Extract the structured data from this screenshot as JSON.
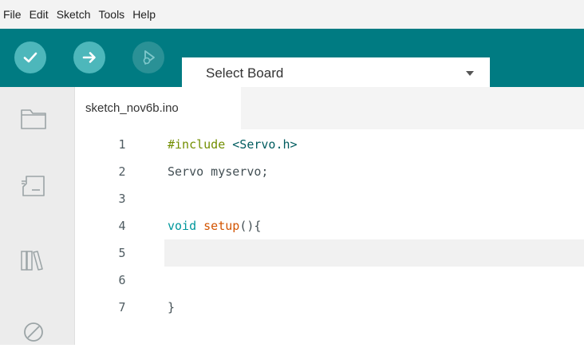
{
  "menu": [
    "File",
    "Edit",
    "Sketch",
    "Tools",
    "Help"
  ],
  "toolbar": {
    "board_select": {
      "value": "Select Board"
    }
  },
  "tab": {
    "name": "sketch_nov6b.ino"
  },
  "code_lines": [
    {
      "n": "1",
      "tokens": [
        {
          "t": "#include",
          "c": "pre"
        },
        {
          "t": " <Servo.h>",
          "c": "str"
        }
      ]
    },
    {
      "n": "2",
      "tokens": [
        {
          "t": "Servo myservo;",
          "c": ""
        }
      ]
    },
    {
      "n": "3",
      "tokens": []
    },
    {
      "n": "4",
      "tokens": [
        {
          "t": "void",
          "c": "kw"
        },
        {
          "t": " ",
          "c": ""
        },
        {
          "t": "setup",
          "c": "fn"
        },
        {
          "t": "(){",
          "c": ""
        }
      ]
    },
    {
      "n": "5",
      "tokens": []
    },
    {
      "n": "6",
      "tokens": []
    },
    {
      "n": "7",
      "tokens": [
        {
          "t": "}",
          "c": ""
        }
      ]
    }
  ],
  "icons": {
    "verify": "check-icon",
    "upload": "arrow-right-icon",
    "debug": "debug-icon",
    "dropdown": "caret-down-icon",
    "sketchbook": "folder-icon",
    "boards_manager": "board-icon",
    "library_manager": "library-icon",
    "debugger_panel": "no-entry-icon"
  },
  "colors": {
    "toolbar_bg": "#007b82",
    "toolbar_button": "#4db7bb",
    "preprocessor": "#728e00",
    "keyword": "#00979c",
    "function": "#d35400"
  }
}
